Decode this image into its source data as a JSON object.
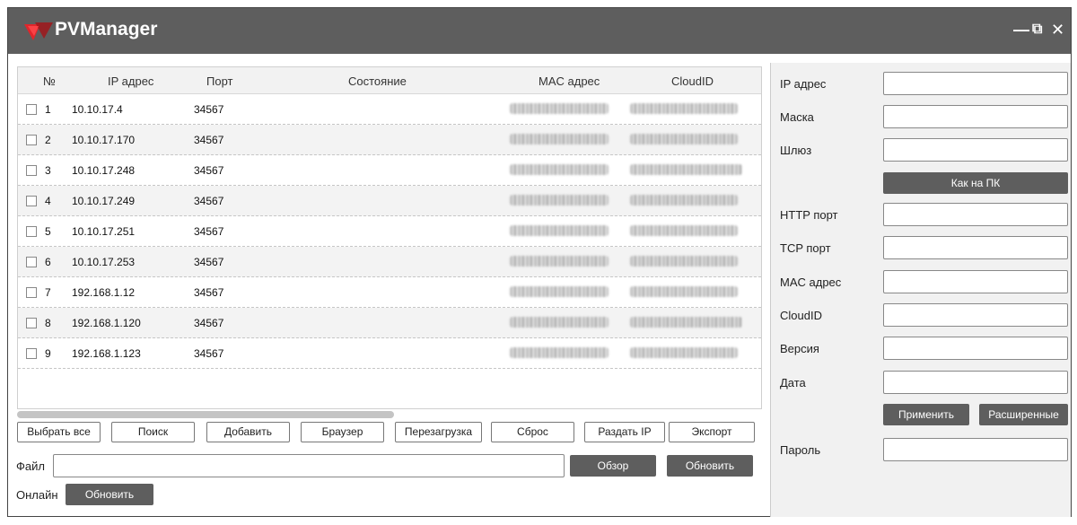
{
  "app": {
    "title": "PVManager",
    "minimize_glyph": "—",
    "restore_glyph": "⧉",
    "close_glyph": "✕",
    "logo_color": "#e0262b"
  },
  "table": {
    "headers": {
      "num": "№",
      "ip": "IP адрес",
      "port": "Порт",
      "state": "Состояние",
      "mac": "MAC адрес",
      "cloud": "CloudID"
    },
    "rows": [
      {
        "num": "1",
        "ip": "10.10.17.4",
        "port": "34567"
      },
      {
        "num": "2",
        "ip": "10.10.17.170",
        "port": "34567"
      },
      {
        "num": "3",
        "ip": "10.10.17.248",
        "port": "34567"
      },
      {
        "num": "4",
        "ip": "10.10.17.249",
        "port": "34567"
      },
      {
        "num": "5",
        "ip": "10.10.17.251",
        "port": "34567"
      },
      {
        "num": "6",
        "ip": "10.10.17.253",
        "port": "34567"
      },
      {
        "num": "7",
        "ip": "192.168.1.12",
        "port": "34567"
      },
      {
        "num": "8",
        "ip": "192.168.1.120",
        "port": "34567"
      },
      {
        "num": "9",
        "ip": "192.168.1.123",
        "port": "34567"
      }
    ]
  },
  "toolbar": {
    "select_all": "Выбрать все",
    "search": "Поиск",
    "add": "Добавить",
    "browser": "Браузер",
    "reboot": "Перезагрузка",
    "reset": "Сброс",
    "distribute_ip": "Раздать IP",
    "export": "Экспорт"
  },
  "file": {
    "label": "Файл",
    "value": "",
    "browse": "Обзор",
    "update": "Обновить"
  },
  "online": {
    "label": "Онлайн",
    "update": "Обновить"
  },
  "panel": {
    "ip": "IP адрес",
    "mask": "Маска",
    "gateway": "Шлюз",
    "as_pc": "Как на ПК",
    "http_port": "HTTP порт",
    "tcp_port": "TCP порт",
    "mac": "MAC адрес",
    "cloud": "CloudID",
    "version": "Версия",
    "date": "Дата",
    "apply": "Применить",
    "advanced": "Расширенные",
    "password": "Пароль"
  },
  "colors": {
    "titlebar": "#5e5e5e",
    "button_dark": "#5e5e5e",
    "panel_bg": "#f1f1f1"
  }
}
